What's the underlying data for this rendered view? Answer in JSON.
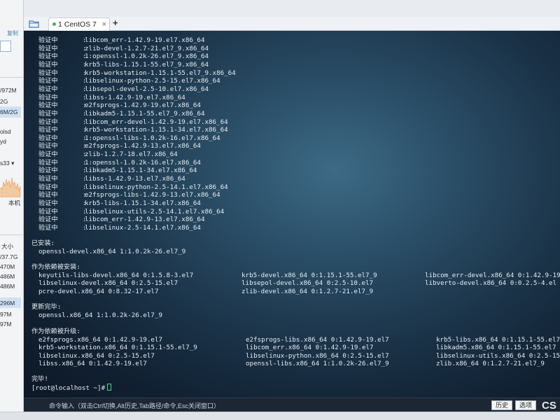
{
  "left_panel": {
    "copy_label": "复制",
    "lines": [
      "/972M",
      "2G",
      "6M/2G",
      "olsd",
      "yd",
      "s33 ▾",
      "本机",
      "大小",
      "/37.7G",
      "470M",
      "486M",
      "486M",
      "296M",
      "97M",
      "97M"
    ]
  },
  "tabs": [
    {
      "label": "1 CentOS 7",
      "close": "×"
    }
  ],
  "tab_add": "+",
  "terminal": {
    "verify_lines": [
      {
        "label": "验证中",
        "sep": ":",
        "pkg": "libcom_err-1.42.9-19.el7.x86_64"
      },
      {
        "label": "验证中",
        "sep": ":",
        "pkg": "zlib-devel-1.2.7-21.el7_9.x86_64"
      },
      {
        "label": "验证中",
        "sep": ":",
        "pkg": "1:openssl-1.0.2k-26.el7_9.x86_64"
      },
      {
        "label": "验证中",
        "sep": ":",
        "pkg": "krb5-libs-1.15.1-55.el7_9.x86_64"
      },
      {
        "label": "验证中",
        "sep": ":",
        "pkg": "krb5-workstation-1.15.1-55.el7_9.x86_64"
      },
      {
        "label": "验证中",
        "sep": ":",
        "pkg": "libselinux-python-2.5-15.el7.x86_64"
      },
      {
        "label": "验证中",
        "sep": ":",
        "pkg": "libsepol-devel-2.5-10.el7.x86_64"
      },
      {
        "label": "验证中",
        "sep": ":",
        "pkg": "libss-1.42.9-19.el7.x86_64"
      },
      {
        "label": "验证中",
        "sep": ":",
        "pkg": "e2fsprogs-1.42.9-19.el7.x86_64"
      },
      {
        "label": "验证中",
        "sep": ":",
        "pkg": "libkadm5-1.15.1-55.el7_9.x86_64"
      },
      {
        "label": "验证中",
        "sep": ":",
        "pkg": "libcom_err-devel-1.42.9-19.el7.x86_64"
      },
      {
        "label": "验证中",
        "sep": ":",
        "pkg": "krb5-workstation-1.15.1-34.el7.x86_64"
      },
      {
        "label": "验证中",
        "sep": ":",
        "pkg": "1:openssl-libs-1.0.2k-16.el7.x86_64"
      },
      {
        "label": "验证中",
        "sep": ":",
        "pkg": "e2fsprogs-1.42.9-13.el7.x86_64"
      },
      {
        "label": "验证中",
        "sep": ":",
        "pkg": "zlib-1.2.7-18.el7.x86_64"
      },
      {
        "label": "验证中",
        "sep": ":",
        "pkg": "1:openssl-1.0.2k-16.el7.x86_64"
      },
      {
        "label": "验证中",
        "sep": ":",
        "pkg": "libkadm5-1.15.1-34.el7.x86_64"
      },
      {
        "label": "验证中",
        "sep": ":",
        "pkg": "libss-1.42.9-13.el7.x86_64"
      },
      {
        "label": "验证中",
        "sep": ":",
        "pkg": "libselinux-python-2.5-14.1.el7.x86_64"
      },
      {
        "label": "验证中",
        "sep": ":",
        "pkg": "e2fsprogs-libs-1.42.9-13.el7.x86_64"
      },
      {
        "label": "验证中",
        "sep": ":",
        "pkg": "krb5-libs-1.15.1-34.el7.x86_64"
      },
      {
        "label": "验证中",
        "sep": ":",
        "pkg": "libselinux-utils-2.5-14.1.el7.x86_64"
      },
      {
        "label": "验证中",
        "sep": ":",
        "pkg": "libcom_err-1.42.9-13.el7.x86_64"
      },
      {
        "label": "验证中",
        "sep": ":",
        "pkg": "libselinux-2.5-14.1.el7.x86_64"
      }
    ],
    "installed_header": "已安装:",
    "installed": [
      "openssl-devel.x86_64 1:1.0.2k-26.el7_9"
    ],
    "dep_installed_header": "作为依赖被安装:",
    "dep_installed": [
      [
        "keyutils-libs-devel.x86_64 0:1.5.8-3.el7",
        "krb5-devel.x86_64 0:1.15.1-55.el7_9",
        "libcom_err-devel.x86_64 0:1.42.9-19"
      ],
      [
        "libselinux-devel.x86_64 0:2.5-15.el7",
        "libsepol-devel.x86_64 0:2.5-10.el7",
        "libverto-devel.x86_64 0:0.2.5-4.el"
      ],
      [
        "pcre-devel.x86_64 0:8.32-17.el7",
        "zlib-devel.x86_64 0:1.2.7-21.el7_9",
        ""
      ]
    ],
    "updated_header": "更新完毕:",
    "updated": [
      "openssl.x86_64 1:1.0.2k-26.el7_9"
    ],
    "dep_upgraded_header": "作为依赖被升级:",
    "dep_upgraded": [
      [
        "e2fsprogs.x86_64 0:1.42.9-19.el7",
        "e2fsprogs-libs.x86_64 0:1.42.9-19.el7",
        "krb5-libs.x86_64 0:1.15.1-55.el7"
      ],
      [
        "krb5-workstation.x86_64 0:1.15.1-55.el7_9",
        "libcom_err.x86_64 0:1.42.9-19.el7",
        "libkadm5.x86_64 0:1.15.1-55.el7"
      ],
      [
        "libselinux.x86_64 0:2.5-15.el7",
        "libselinux-python.x86_64 0:2.5-15.el7",
        "libselinux-utils.x86_64 0:2.5-15"
      ],
      [
        "libss.x86_64 0:1.42.9-19.el7",
        "openssl-libs.x86_64 1:1.0.2k-26.el7_9",
        "zlib.x86_64 0:1.2.7-21.el7_9"
      ]
    ],
    "complete": "完毕!",
    "prompt": "[root@localhost ~]#"
  },
  "command_bar": {
    "hint": "命令输入（双击Ctrl切换,Alt历史,Tab路径/命令,Esc关闭窗口）",
    "history_label": "历史",
    "options_label": "选项",
    "logo_text": "CS"
  },
  "colors": {
    "terminal_bg": "#1b3348",
    "terminal_fg": "#e6edf3",
    "cursor": "#3ddc84",
    "tab_dot": "#4caf50"
  }
}
